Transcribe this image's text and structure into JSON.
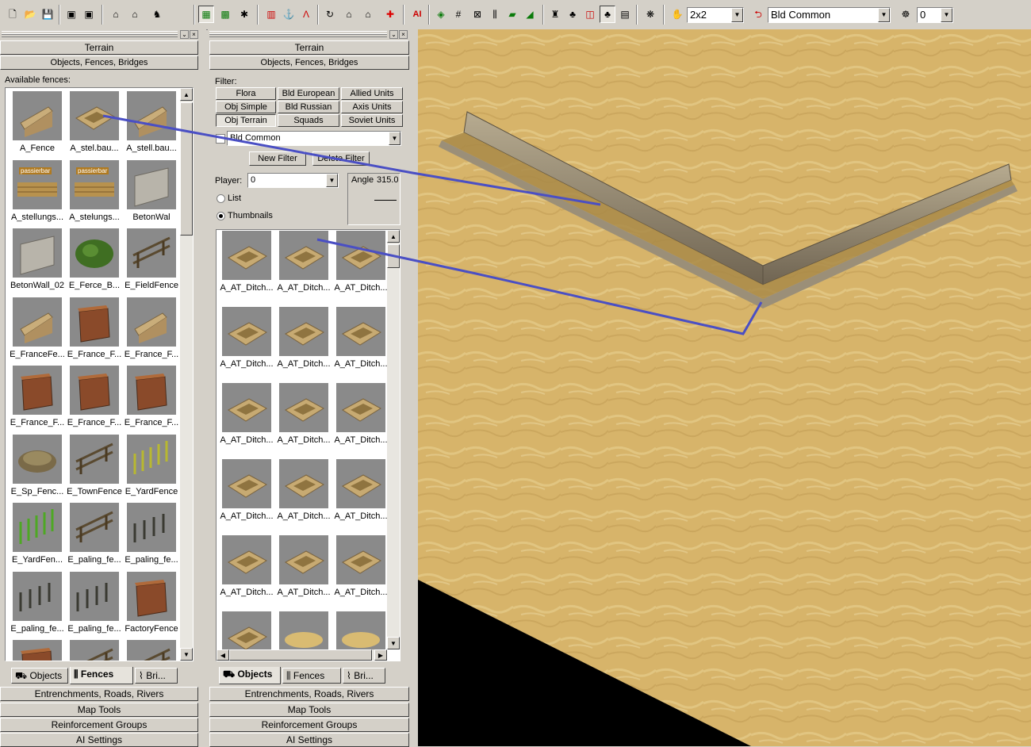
{
  "toolbar": {
    "brush_size": "2x2",
    "filter": "Bld Common",
    "player": "0",
    "ai_label": "AI"
  },
  "left_panel": {
    "header_terrain": "Terrain",
    "header_objects": "Objects, Fences, Bridges",
    "available_label": "Available fences:",
    "items": [
      {
        "caption": "A_Fence",
        "kind": "stone"
      },
      {
        "caption": "A_stel.bau...",
        "kind": "ditch"
      },
      {
        "caption": "A_stell.bau...",
        "kind": "stone"
      },
      {
        "caption": "A_stellungs...",
        "kind": "logs",
        "tag": "passierbar"
      },
      {
        "caption": "A_stelungs...",
        "kind": "logs",
        "tag": "passierbar"
      },
      {
        "caption": "BetonWal",
        "kind": "concrete"
      },
      {
        "caption": "BetonWall_02",
        "kind": "concrete"
      },
      {
        "caption": "E_Ferce_B...",
        "kind": "hedge"
      },
      {
        "caption": "E_FieldFence",
        "kind": "wood"
      },
      {
        "caption": "E_FranceFe...",
        "kind": "stone"
      },
      {
        "caption": "E_France_F...",
        "kind": "brick"
      },
      {
        "caption": "E_France_F...",
        "kind": "stone"
      },
      {
        "caption": "E_France_F...",
        "kind": "brick"
      },
      {
        "caption": "E_France_F...",
        "kind": "brick"
      },
      {
        "caption": "E_France_F...",
        "kind": "brick"
      },
      {
        "caption": "E_Sp_Fenc...",
        "kind": "bush"
      },
      {
        "caption": "E_TownFence",
        "kind": "wood"
      },
      {
        "caption": "E_YardFence",
        "kind": "yellow"
      },
      {
        "caption": "E_YardFen...",
        "kind": "green"
      },
      {
        "caption": "E_paling_fe...",
        "kind": "wood"
      },
      {
        "caption": "E_paling_fe...",
        "kind": "dark"
      },
      {
        "caption": "E_paling_fe...",
        "kind": "dark"
      },
      {
        "caption": "E_paling_fe...",
        "kind": "dark"
      },
      {
        "caption": "FactoryFence",
        "kind": "brick"
      },
      {
        "caption": "",
        "kind": "brick"
      },
      {
        "caption": "",
        "kind": "wood"
      },
      {
        "caption": "",
        "kind": "wood"
      }
    ],
    "tabs": [
      "Objects",
      "Fences",
      "Bri..."
    ],
    "active_tab": 1,
    "bottom_bars": [
      "Entrenchments, Roads, Rivers",
      "Map Tools",
      "Reinforcement Groups",
      "AI Settings"
    ]
  },
  "middle_panel": {
    "header_terrain": "Terrain",
    "header_objects": "Objects, Fences, Bridges",
    "filter_label": "Filter:",
    "filter_buttons": [
      [
        "Flora",
        "Bld European",
        "Allied Units"
      ],
      [
        "Obj Simple",
        "Bld Russian",
        "Axis Units"
      ],
      [
        "Obj Terrain",
        "Squads",
        "Soviet Units"
      ]
    ],
    "pressed_filter": "Obj Terrain",
    "filter_combo": "Bld Common",
    "new_filter": "New Filter",
    "delete_filter": "Delete Filter",
    "player_label": "Player:",
    "player_value": "0",
    "angle_label": "Angle",
    "angle_value": "315.0",
    "view_list": "List",
    "view_thumbnails": "Thumbnails",
    "items": [
      {
        "caption": "A_AT_Ditch...",
        "kind": "ditch"
      },
      {
        "caption": "A_AT_Ditch...",
        "kind": "ditch"
      },
      {
        "caption": "A_AT_Ditch...",
        "kind": "ditch"
      },
      {
        "caption": "A_AT_Ditch...",
        "kind": "ditch"
      },
      {
        "caption": "A_AT_Ditch...",
        "kind": "ditch"
      },
      {
        "caption": "A_AT_Ditch...",
        "kind": "ditch"
      },
      {
        "caption": "A_AT_Ditch...",
        "kind": "ditch"
      },
      {
        "caption": "A_AT_Ditch...",
        "kind": "ditch"
      },
      {
        "caption": "A_AT_Ditch...",
        "kind": "ditch"
      },
      {
        "caption": "A_AT_Ditch...",
        "kind": "ditch"
      },
      {
        "caption": "A_AT_Ditch...",
        "kind": "ditch"
      },
      {
        "caption": "A_AT_Ditch...",
        "kind": "ditch"
      },
      {
        "caption": "A_AT_Ditch...",
        "kind": "ditch"
      },
      {
        "caption": "A_AT_Ditch...",
        "kind": "ditch"
      },
      {
        "caption": "A_AT_Ditch...",
        "kind": "ditch"
      },
      {
        "caption": "",
        "kind": "ditch"
      },
      {
        "caption": "",
        "kind": "sand"
      },
      {
        "caption": "",
        "kind": "sand"
      }
    ],
    "tabs": [
      "Objects",
      "Fences",
      "Bri..."
    ],
    "active_tab": 0,
    "bottom_bars": [
      "Entrenchments, Roads, Rivers",
      "Map Tools",
      "Reinforcement Groups",
      "AI Settings"
    ]
  },
  "colors": {
    "sand": "#d7b46a",
    "callout_line": "#4a4fc4",
    "panel": "#d4d0c8"
  }
}
